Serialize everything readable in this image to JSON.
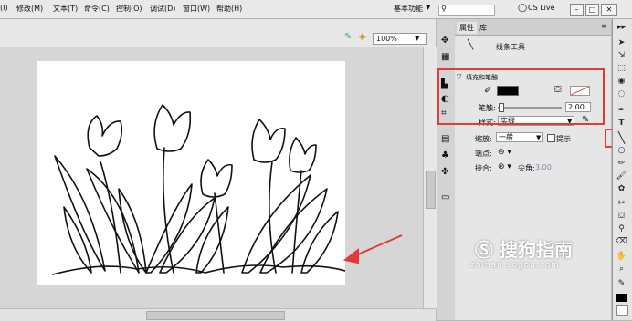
{
  "menubar": {
    "items": [
      "(I)",
      "修改(M)",
      "文本(T)",
      "命令(C)",
      "控制(O)",
      "调试(D)",
      "窗口(W)",
      "帮助(H)"
    ],
    "workspace": "基本功能",
    "cslive": "CS Live"
  },
  "stage": {
    "zoom": "100%"
  },
  "props": {
    "tabs": [
      "属性",
      "库"
    ],
    "tool_name": "线条工具",
    "fill_stroke_section": "填充和笔触",
    "stroke_label": "笔触:",
    "stroke_value": "2.00",
    "style_label": "样式:",
    "style_value": "实线",
    "scale_label": "缩放:",
    "scale_value": "一般",
    "hint_label": "提示",
    "cap_label": "端点:",
    "join_label": "接合:",
    "miter_label": "尖角:",
    "miter_value": "3.00"
  },
  "watermark": {
    "text": "搜狗指南",
    "url": "zhinan.sogou.com"
  },
  "colors": {
    "annotation": "#e23b3b",
    "stroke_color": "#000000"
  }
}
